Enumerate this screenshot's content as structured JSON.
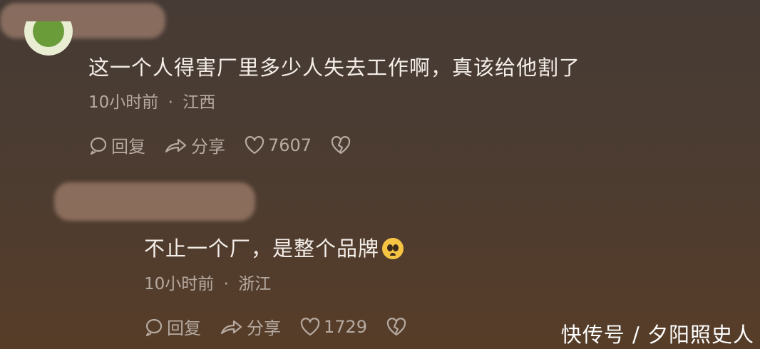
{
  "comments": [
    {
      "text": "这一个人得害厂里多少人失去工作啊，真该给他割了",
      "time": "10小时前",
      "sep": "·",
      "location": "江西",
      "reply_label": "回复",
      "share_label": "分享",
      "likes": "7607"
    },
    {
      "text": "不止一个厂，是整个品牌",
      "emoji": "pleading-face",
      "time": "10小时前",
      "sep": "·",
      "location": "浙江",
      "reply_label": "回复",
      "share_label": "分享",
      "likes": "1729"
    }
  ],
  "watermark": "快传号 / 夕阳照史人",
  "icons": {
    "reply": "speech-bubble-icon",
    "share": "share-arrow-icon",
    "like": "heart-icon",
    "dislike": "broken-heart-icon"
  },
  "colors": {
    "text": "#f4eee9",
    "meta": "#b6aaa1",
    "background_top": "#463b35",
    "background_bottom": "#573d28"
  }
}
